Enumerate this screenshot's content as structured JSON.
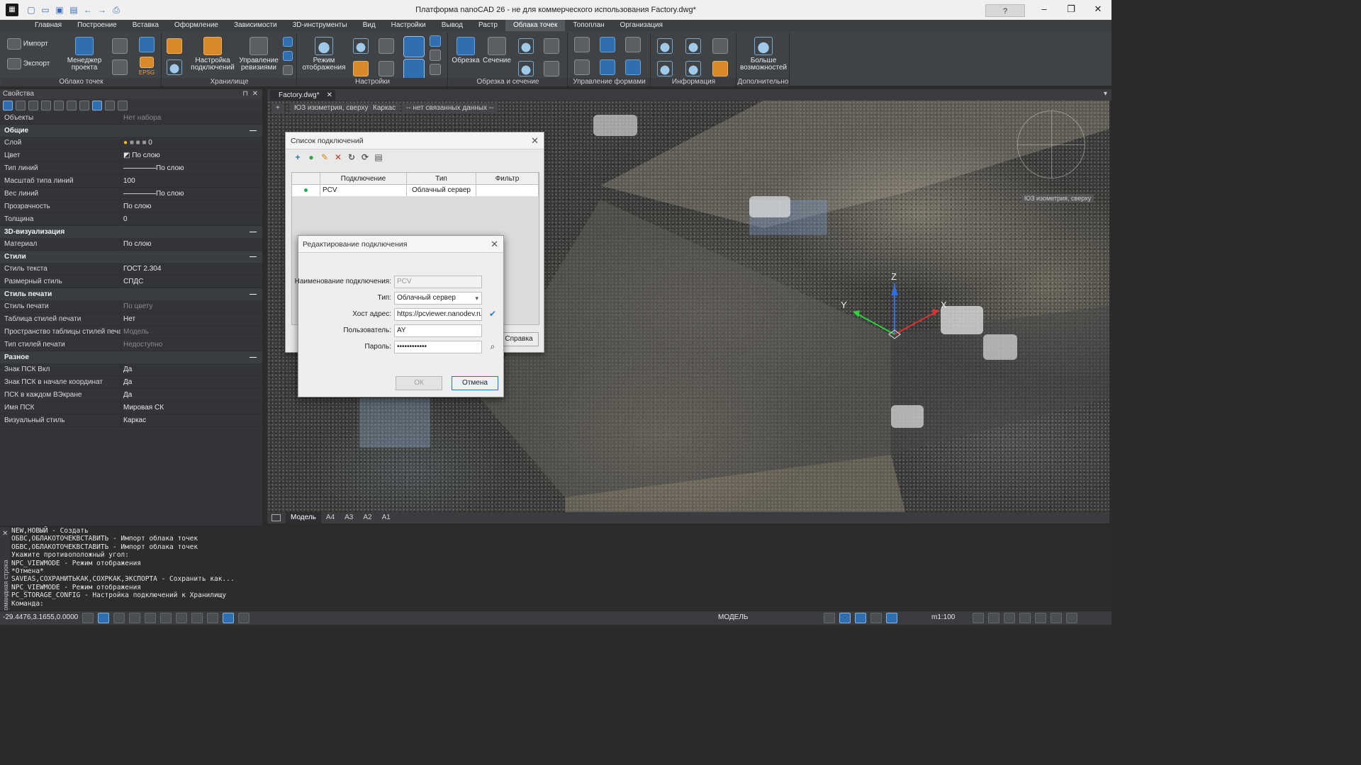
{
  "window": {
    "title": "Платформа nanoCAD 26 - не для коммерческого использования Factory.dwg*",
    "help_label": "?"
  },
  "menu": [
    {
      "label": "Главная"
    },
    {
      "label": "Построение"
    },
    {
      "label": "Вставка"
    },
    {
      "label": "Оформление"
    },
    {
      "label": "Зависимости"
    },
    {
      "label": "3D-инструменты"
    },
    {
      "label": "Вид"
    },
    {
      "label": "Настройки"
    },
    {
      "label": "Вывод"
    },
    {
      "label": "Растр"
    },
    {
      "label": "Облака точек"
    },
    {
      "label": "Топоплан"
    },
    {
      "label": "Организация"
    }
  ],
  "active_menu": "Облака точек",
  "ribbon": {
    "groups": {
      "cloud": "Облако точек",
      "storage": "Хранилище",
      "settings": "Настройки",
      "clip": "Обрезка и сечение",
      "shapes": "Управление формами",
      "info": "Информация",
      "extra": "Дополнительно"
    },
    "buttons": {
      "import": "Импорт",
      "export": "Экспорт",
      "project_manager_1": "Менеджер",
      "project_manager_2": "проекта",
      "epsg": "EPSG",
      "conn_settings_1": "Настройка",
      "conn_settings_2": "подключений",
      "revisions_1": "Управление",
      "revisions_2": "ревизиями",
      "display_mode_1": "Режим",
      "display_mode_2": "отображения",
      "clip": "Обрезка",
      "section": "Сечение",
      "more_1": "Больше",
      "more_2": "возможностей"
    }
  },
  "properties": {
    "title": "Свойства",
    "objects_label": "Объекты",
    "objects_value": "Нет набора",
    "sections": {
      "general": "Общие",
      "viz3d": "3D-визуализация",
      "styles": "Стили",
      "plotstyle": "Стиль печати",
      "misc": "Разное"
    },
    "general": [
      {
        "k": "Слой",
        "v": "0"
      },
      {
        "k": "Цвет",
        "v": "По слою"
      },
      {
        "k": "Тип линий",
        "v": "По слою"
      },
      {
        "k": "Масштаб типа линий",
        "v": "100"
      },
      {
        "k": "Вес линий",
        "v": "По слою"
      },
      {
        "k": "Прозрачность",
        "v": "По слою"
      },
      {
        "k": "Толщина",
        "v": "0"
      }
    ],
    "viz3d": [
      {
        "k": "Материал",
        "v": "По слою"
      }
    ],
    "styles": [
      {
        "k": "Стиль текста",
        "v": "ГОСТ 2.304"
      },
      {
        "k": "Размерный стиль",
        "v": "СПДС"
      }
    ],
    "plotstyle": [
      {
        "k": "Стиль печати",
        "v": "По цвету"
      },
      {
        "k": "Таблица стилей печати",
        "v": "Нет"
      },
      {
        "k": "Пространство таблицы стилей печати",
        "v": "Модель"
      },
      {
        "k": "Тип стилей печати",
        "v": "Недоступно"
      }
    ],
    "misc": [
      {
        "k": "Знак ПСК Вкл",
        "v": "Да"
      },
      {
        "k": "Знак ПСК в начале координат",
        "v": "Да"
      },
      {
        "k": "ПСК в каждом ВЭкране",
        "v": "Да"
      },
      {
        "k": "Имя ПСК",
        "v": "Мировая СК"
      },
      {
        "k": "Визуальный стиль",
        "v": "Каркас"
      }
    ]
  },
  "doc_tab": "Factory.dwg*",
  "viewport": {
    "controls": [
      "+",
      "ЮЗ изометрия, сверху",
      "Каркас",
      "-- нет связанных данных --"
    ],
    "viewcube_label": "ЮЗ изометрия, сверху",
    "axes": {
      "z": "Z",
      "y": "Y",
      "x": "X"
    }
  },
  "model_tabs": [
    "Модель",
    "A4",
    "A3",
    "A2",
    "A1"
  ],
  "command_line": {
    "side_label": "Командная строка",
    "lines": [
      "NEW,НОВЫЙ - Создать",
      "ОБВС,ОБЛАКОТОЧЕКВСТАВИТЬ - Импорт облака точек",
      "ОБВС,ОБЛАКОТОЧЕКВСТАВИТЬ - Импорт облака точек",
      "Укажите противоположный угол:",
      "NPC_VIEWMODE - Режим отображения",
      "*Отмена*",
      "SAVEAS,СОХРАНИТЬКАК,СОХРКАК,ЭКСПОРТА - Сохранить как...",
      "NPC_VIEWMODE - Режим отображения",
      "PC_STORAGE_CONFIG - Настройка подключений к Хранилищу",
      "Команда:"
    ]
  },
  "status": {
    "coords": "-29.4476,3.1655,0.0000",
    "model": "МОДЕЛЬ",
    "scale": "m1:100"
  },
  "conn_list_dialog": {
    "title": "Список подключений",
    "columns": [
      "",
      "Подключение",
      "Тип",
      "Фильтр"
    ],
    "rows": [
      {
        "name": "PCV",
        "type": "Облачный сервер",
        "filter": ""
      }
    ],
    "help_button": "Справка"
  },
  "edit_dialog": {
    "title": "Редактирование подключения",
    "fields": {
      "name_label": "Наименование подключения:",
      "name_value": "PCV",
      "type_label": "Тип:",
      "type_value": "Облачный сервер",
      "host_label": "Хост адрес:",
      "host_value": "https://pcviewer.nanodev.ru",
      "user_label": "Пользователь:",
      "user_value": "AY",
      "pass_label": "Пароль:",
      "pass_value": "••••••••••••"
    },
    "ok": "ОК",
    "cancel": "Отмена"
  }
}
